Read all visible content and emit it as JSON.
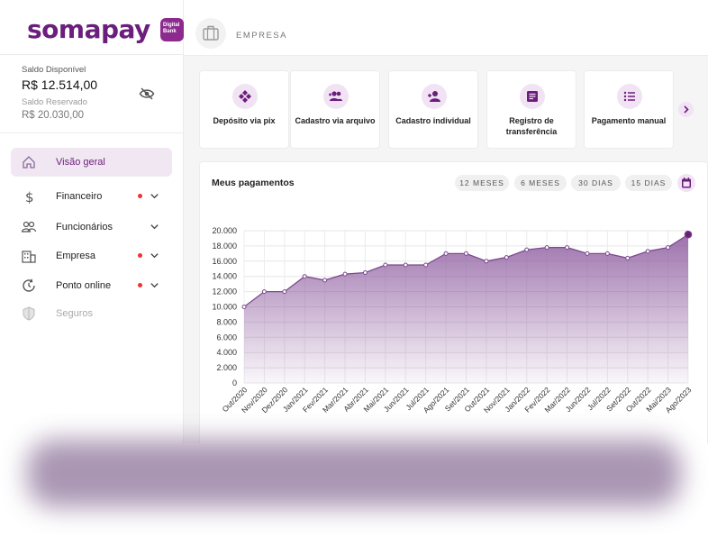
{
  "brand": {
    "name": "somapay",
    "badge_line1": "Digital",
    "badge_line2": "Bank",
    "color": "#6b1e7c"
  },
  "balance": {
    "available_label": "Saldo Disponível",
    "available_value": "R$ 12.514,00",
    "reserved_label": "Saldo Reservado",
    "reserved_value": "R$ 20.030,00"
  },
  "sidebar": {
    "items": [
      {
        "label": "Visão geral",
        "icon": "home-icon",
        "active": true,
        "dot": false,
        "chevron": false
      },
      {
        "label": "Financeiro",
        "icon": "dollar-icon",
        "active": false,
        "dot": true,
        "chevron": true
      },
      {
        "label": "Funcionários",
        "icon": "people-icon",
        "active": false,
        "dot": false,
        "chevron": true
      },
      {
        "label": "Empresa",
        "icon": "building-icon",
        "active": false,
        "dot": true,
        "chevron": true
      },
      {
        "label": "Ponto online",
        "icon": "clock-icon",
        "active": false,
        "dot": true,
        "chevron": true
      },
      {
        "label": "Seguros",
        "icon": "shield-icon",
        "active": false,
        "dot": false,
        "chevron": false,
        "disabled": true
      }
    ]
  },
  "header": {
    "title": "EMPRESA",
    "icon": "briefcase-icon"
  },
  "actions": [
    {
      "label": "Depósito via pix",
      "icon": "pix-icon"
    },
    {
      "label": "Cadastro via arquivo",
      "icon": "group-add-icon"
    },
    {
      "label": "Cadastro individual",
      "icon": "person-add-icon"
    },
    {
      "label": "Registro de transferência",
      "icon": "document-icon"
    },
    {
      "label": "Pagamento manual",
      "icon": "list-icon"
    }
  ],
  "payments": {
    "title": "Meus pagamentos",
    "filters": [
      "12 MESES",
      "6 MESES",
      "30 DIAS",
      "15 DIAS"
    ]
  },
  "colors": {
    "accent": "#6b1e7c",
    "accent_light": "#f1e3f3",
    "line": "#7d4a8f",
    "dot_alert": "#e33333"
  },
  "chart_data": {
    "type": "area",
    "x": [
      "Out/2020",
      "Nov/2020",
      "Dez/2020",
      "Jan/2021",
      "Fev/2021",
      "Mar/2021",
      "Abr/2021",
      "Mai/2021",
      "Jun/2021",
      "Jul/2021",
      "Ago/2021",
      "Set/2021",
      "Out/2021",
      "Nov/2021",
      "Jan/2022",
      "Fev/2022",
      "Mar/2022",
      "Jun/2022",
      "Jul/2022",
      "Set/2022",
      "Out/2022",
      "Mai/2023",
      "Ago/2023"
    ],
    "values": [
      10000,
      12000,
      12000,
      14000,
      13500,
      14300,
      14500,
      15500,
      15500,
      15500,
      17000,
      17000,
      16000,
      16500,
      17500,
      17800,
      17800,
      17000,
      17000,
      16400,
      17300,
      17800,
      19500
    ],
    "yticks": [
      "0",
      "2.000",
      "4.000",
      "6.000",
      "8.000",
      "10.000",
      "12.000",
      "14.000",
      "16.000",
      "18.000",
      "20.000"
    ],
    "ylim": [
      0,
      20000
    ],
    "grid": true
  }
}
